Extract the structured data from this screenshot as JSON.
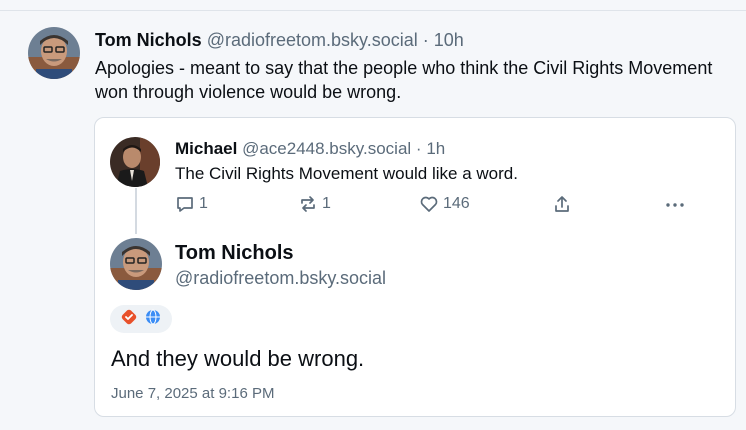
{
  "outer_post": {
    "author_name": "Tom Nichols",
    "handle": "@radiofreetom.bsky.social",
    "separator": "·",
    "time": "10h",
    "text": "Apologies - meant to say that the people who think the Civil Rights Movement won through violence would be wrong."
  },
  "quoted_reply": {
    "author_name": "Michael",
    "handle": "@ace2448.bsky.social",
    "separator": "·",
    "time": "1h",
    "text": "The Civil Rights Movement would like a word.",
    "actions": {
      "reply_count": "1",
      "repost_count": "1",
      "like_count": "146"
    }
  },
  "quoted_post": {
    "author_name": "Tom Nichols",
    "handle": "@radiofreetom.bsky.social",
    "text": "And they would be wrong.",
    "timestamp": "June 7, 2025 at 9:16 PM"
  },
  "colors": {
    "muted": "#5b6b7a",
    "badge_red": "#e8512b",
    "badge_blue": "#3b8df5"
  },
  "icons": [
    "reply-icon",
    "repost-icon",
    "like-icon",
    "share-icon",
    "more-icon",
    "verified-badge-icon",
    "globe-icon"
  ]
}
